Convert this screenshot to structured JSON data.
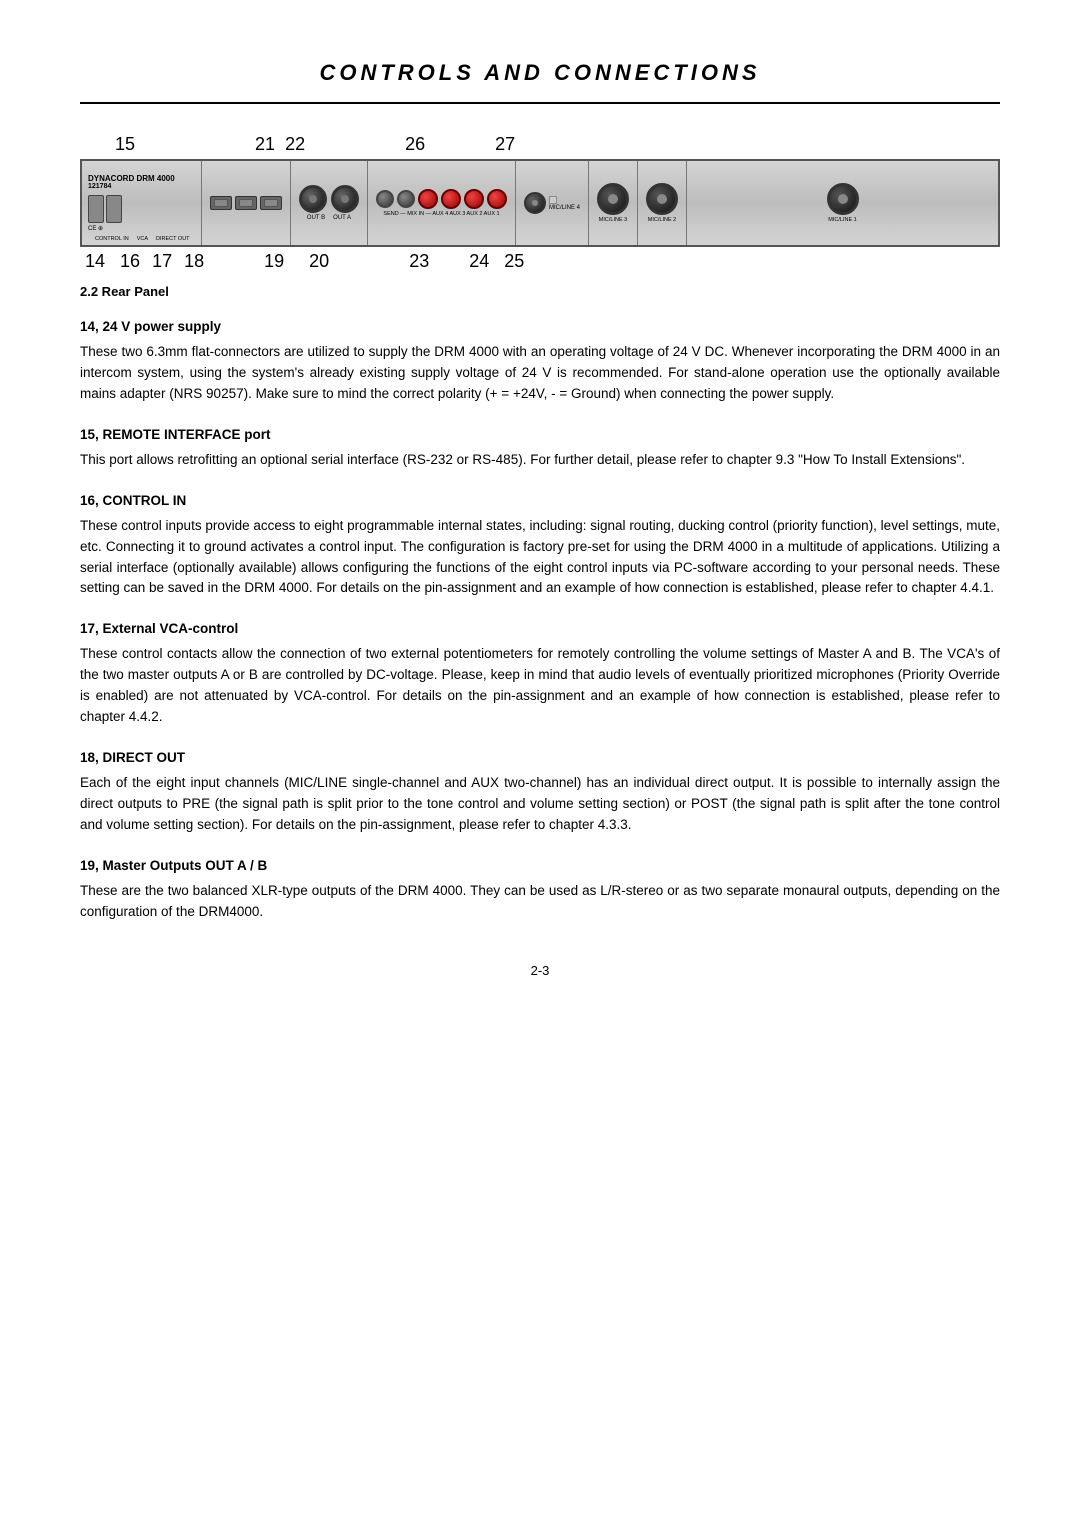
{
  "page": {
    "title": "CONTROLS AND CONNECTIONS",
    "caption": "2.2 Rear Panel",
    "page_number": "2-3"
  },
  "diagram": {
    "top_numbers": [
      "15",
      "21",
      "22",
      "26",
      "27"
    ],
    "bottom_numbers": [
      "14",
      "16",
      "17",
      "18",
      "19",
      "20",
      "23",
      "24",
      "25"
    ]
  },
  "sections": [
    {
      "id": "section-14-24",
      "title": "14, 24 V power supply",
      "body": "These two 6.3mm flat-connectors are utilized to supply the DRM 4000 with an operating voltage of 24 V DC. Whenever incorporating the DRM 4000 in an intercom system, using the system's already existing supply voltage of 24 V is recommended. For stand-alone operation use the optionally available mains adapter (NRS 90257). Make sure to mind the correct polarity (+ = +24V, - = Ground) when connecting the power supply."
    },
    {
      "id": "section-15",
      "title": "15, REMOTE INTERFACE port",
      "body": "This port allows retrofitting an optional serial interface (RS-232 or RS-485). For further detail, please refer to chapter 9.3 \"How To Install Extensions\"."
    },
    {
      "id": "section-16",
      "title": "16, CONTROL IN",
      "body": "These control inputs provide access to eight programmable internal states, including: signal routing, ducking control (priority function), level settings, mute, etc. Connecting it to ground activates a control input. The configuration is factory pre-set for using the DRM 4000 in a multitude of applications. Utilizing a serial interface (optionally available) allows configuring the functions of the eight control inputs via PC-software according to your personal needs. These setting can be saved in the DRM 4000. For details on the pin-assignment and an example of how connection is established, please refer to chapter 4.4.1."
    },
    {
      "id": "section-17",
      "title": "17, External VCA-control",
      "body": "These control contacts allow the connection of two external potentiometers for remotely controlling the volume settings of Master A and B. The VCA's of the two master outputs A or B are controlled by DC-voltage. Please, keep in mind that audio levels of eventually prioritized microphones (Priority Override is enabled) are not attenuated by VCA-control. For details on the pin-assignment and an example of how connection is established, please refer to chapter 4.4.2."
    },
    {
      "id": "section-18",
      "title": "18, DIRECT OUT",
      "body": "Each of the eight input channels (MIC/LINE single-channel and AUX two-channel) has an individual direct output. It is possible to internally assign the direct outputs to PRE (the signal path is split prior to the tone control and volume setting section) or POST (the signal path is split after the tone control and volume setting section). For details on the pin-assignment, please refer to chapter 4.3.3."
    },
    {
      "id": "section-19",
      "title": "19, Master Outputs OUT A / B",
      "body": "These are the two balanced XLR-type outputs of the DRM 4000. They can be used as L/R-stereo or as two separate monaural outputs, depending on the configuration of the DRM4000."
    }
  ]
}
